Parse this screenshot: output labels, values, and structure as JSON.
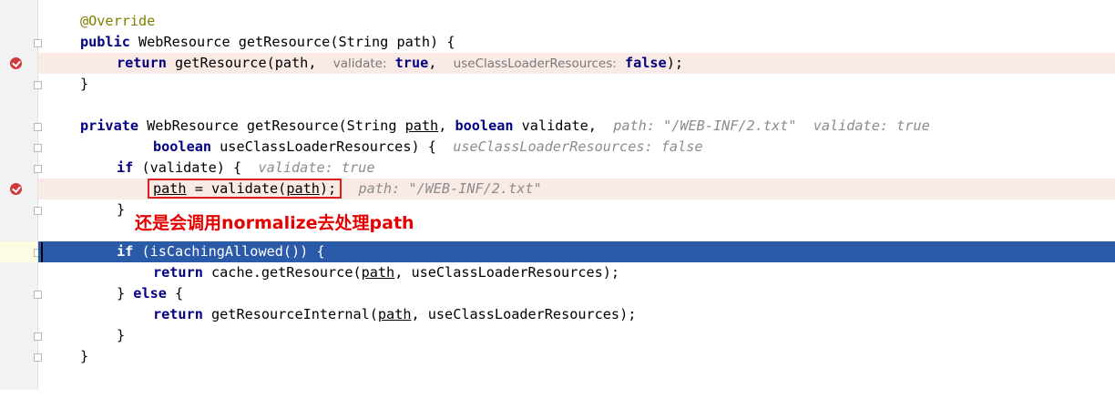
{
  "editor": {
    "callout": "还是会调用normalize去处理path",
    "code": {
      "l1": {
        "ann": "@Override"
      },
      "l2": {
        "kw": "public",
        "text": " WebResource getResource(String path) {"
      },
      "l3": {
        "kw": "return",
        "t1": " getResource(path,  ",
        "h1": "validate:",
        "k1": " true",
        "t2": ",  ",
        "h2": "useClassLoaderResources:",
        "k2": " false",
        "t3": ");"
      },
      "l4": {
        "text": "}"
      },
      "l6": {
        "kw": "private",
        "t1": " WebResource getResource(String ",
        "p1": "path",
        "t2": ", ",
        "kw2": "boolean",
        "t3": " validate,  ",
        "i1": "path: \"/WEB-INF/2.txt\"  validate: true"
      },
      "l7": {
        "kw": "boolean",
        "t1": " useClassLoaderResources) {  ",
        "i1": "useClassLoaderResources: false"
      },
      "l8": {
        "kw": "if",
        "t1": " (validate) {  ",
        "i1": "validate: true"
      },
      "l9": {
        "p1": "path",
        "t1": " = validate(",
        "p2": "path",
        "t2": ");",
        "i1": "path: \"/WEB-INF/2.txt\""
      },
      "l10": {
        "text": "}"
      },
      "l12": {
        "kw": "if",
        "t1": " (isCachingAllowed()) {"
      },
      "l13": {
        "kw": "return",
        "t1": " cache.getResource(",
        "p1": "path",
        "t2": ", useClassLoaderResources);"
      },
      "l14": {
        "t0": "} ",
        "kw": "else",
        "t1": " {"
      },
      "l15": {
        "kw": "return",
        "t1": " getResourceInternal(",
        "p1": "path",
        "t2": ", useClassLoaderResources);"
      },
      "l16": {
        "text": "}"
      },
      "l17": {
        "text": "}"
      }
    }
  }
}
